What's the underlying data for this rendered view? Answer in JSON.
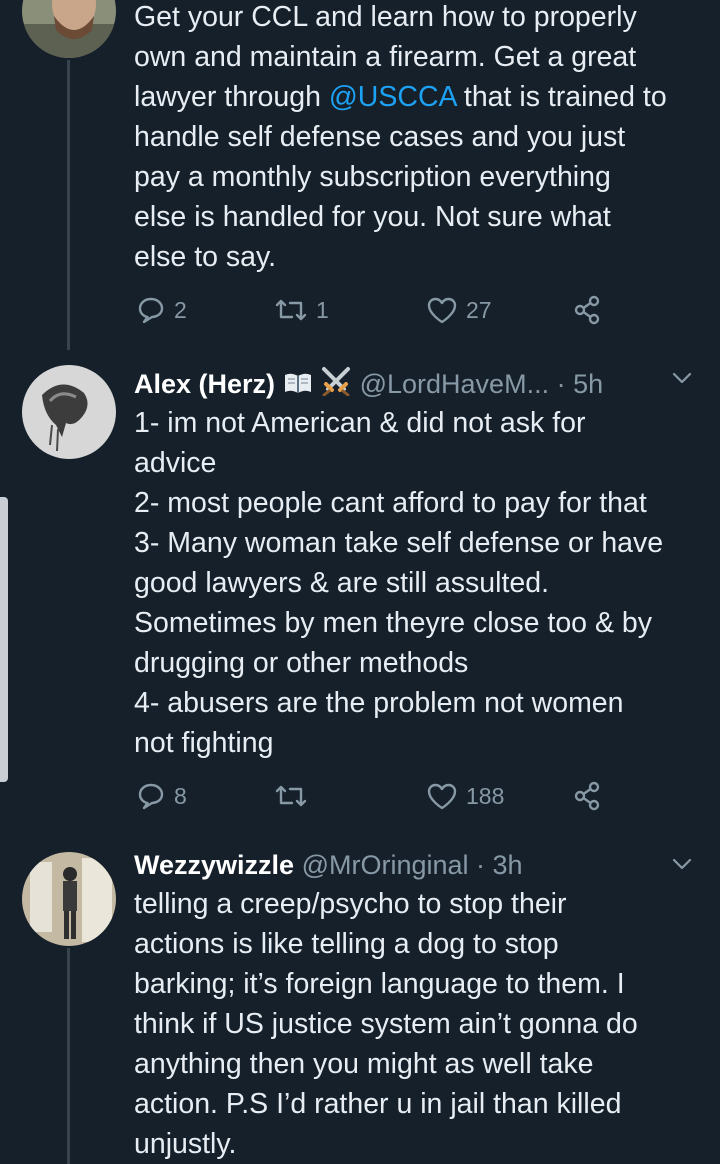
{
  "tweets": [
    {
      "text_lines": [
        "Get your CCL and learn how to properly",
        "own and maintain a firearm. Get a great",
        "lawyer through ",
        "handle self defense cases and you just",
        "pay a monthly subscription everything",
        "else is handled for you. Not sure what",
        "else to say."
      ],
      "mention": "@USCCA",
      "mention_suffix": " that is trained to",
      "replies": "2",
      "retweets": "1",
      "likes": "27"
    },
    {
      "name": "Alex (Herz)",
      "handle": "@LordHaveM...",
      "time": "· 5h",
      "text_lines": [
        "1- im not American & did not ask for",
        "advice",
        "2- most people cant afford to pay for that",
        "3- Many woman take self defense or have",
        "good lawyers & are still assulted.",
        "Sometimes by men theyre close too & by",
        "drugging or other methods",
        "4- abusers are the problem not women",
        "not fighting"
      ],
      "replies": "8",
      "retweets": "",
      "likes": "188"
    },
    {
      "name": "Wezzywizzle",
      "handle": "@MrOringinal",
      "time": "· 3h",
      "text_lines": [
        "telling a creep/psycho to stop their",
        "actions is like telling a dog to stop",
        "barking; it’s foreign language to them. I",
        "think if US justice system ain’t gonna do",
        "anything then you might as well take",
        "action. P.S I’d rather u in jail than killed",
        "unjustly."
      ]
    }
  ],
  "icons": {
    "reply": "reply-icon",
    "retweet": "retweet-icon",
    "like": "heart-icon",
    "share": "share-icon",
    "more": "chevron-down-icon",
    "badge1": "book-emoji-icon",
    "badge2": "crossed-swords-emoji-icon"
  },
  "colors": {
    "background": "#15202b",
    "text": "#e7edf2",
    "secondary": "#8899a6",
    "accent": "#1da1f2",
    "thread_line": "#38444d"
  }
}
